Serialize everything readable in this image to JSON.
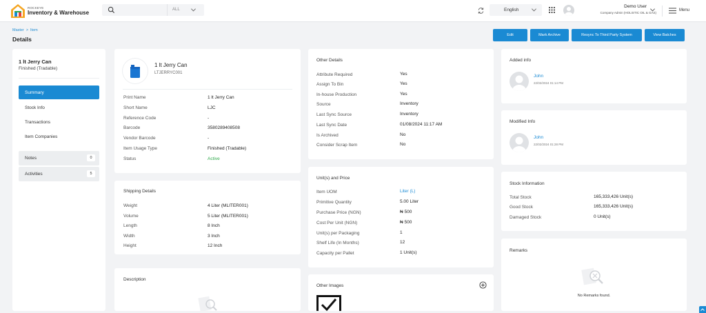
{
  "header": {
    "brand_small": "ROCKEYE",
    "brand_main": "Inventory & Warehouse",
    "search": {
      "placeholder": "",
      "scope": "ALL"
    },
    "language": "English",
    "user_name": "Demo User",
    "user_role": "Company Admin (HOLISTIC OIL & GAS)",
    "menu_label": "Menu"
  },
  "breadcrumb": {
    "root": "Master",
    "current": "Item"
  },
  "page_title": "Details",
  "actions": {
    "edit": "Edit",
    "mark_archive": "Mark Archive",
    "resync": "Resync To Third Party System",
    "view_batches": "View Batches"
  },
  "sidebar": {
    "item_name": "1 lt Jerry Can",
    "item_type": "Finished (Tradable)",
    "nav": [
      "Summary",
      "Stock Info",
      "Transactions",
      "Item Companies"
    ],
    "notes": {
      "label": "Notes",
      "count": "0"
    },
    "activities": {
      "label": "Activities",
      "count": "5"
    }
  },
  "item_card": {
    "name": "1 lt Jerry Can",
    "code": "LTJERRYC001",
    "fields": [
      {
        "label": "Print Name",
        "value": "1 lt Jerry Can"
      },
      {
        "label": "Short Name",
        "value": "LJC"
      },
      {
        "label": "Reference Code",
        "value": "-"
      },
      {
        "label": "Barcode",
        "value": "3580289408508"
      },
      {
        "label": "Vendor Barcode",
        "value": "-"
      },
      {
        "label": "Item Usage Type",
        "value": "Finished (Tradable)"
      },
      {
        "label": "Status",
        "value": "Active"
      }
    ],
    "status_color": "#2ea84a"
  },
  "shipping": {
    "title": "Shipping Details",
    "fields": [
      {
        "label": "Weight",
        "value": "4 Liter (MLITER001)"
      },
      {
        "label": "Volume",
        "value": "5 Liter (MLITER001)"
      },
      {
        "label": "Length",
        "value": "8 Inch"
      },
      {
        "label": "Width",
        "value": "3 Inch"
      },
      {
        "label": "Height",
        "value": "12 Inch"
      }
    ]
  },
  "description": {
    "title": "Description"
  },
  "other_details": {
    "title": "Other Details",
    "fields": [
      {
        "label": "Attribute Required",
        "value": "Yes"
      },
      {
        "label": "Assign To Bin",
        "value": "Yes"
      },
      {
        "label": "In-house Production",
        "value": "Yes"
      },
      {
        "label": "Source",
        "value": "Inventory"
      },
      {
        "label": "Last Sync Source",
        "value": "Inventory"
      },
      {
        "label": "Last Sync Date",
        "value": "01/08/2024 11:17 AM"
      },
      {
        "label": "Is Archived",
        "value": "No"
      },
      {
        "label": "Consider Scrap Item",
        "value": "No"
      }
    ]
  },
  "units": {
    "title": "Unit(s) and Price",
    "fields": [
      {
        "label": "Item UOM",
        "value": "Liter (L)"
      },
      {
        "label": "Primitive Quantity",
        "value": "5.00 Liter"
      },
      {
        "label": "Purchase Price (NGN)",
        "value": "₦ 500"
      },
      {
        "label": "Cost Per Unit (NGN)",
        "value": "₦ 500"
      },
      {
        "label": "Unit(s) per Packaging",
        "value": "1"
      },
      {
        "label": "Shelf Life (In Months)",
        "value": "12"
      },
      {
        "label": "Capacity per Pallet",
        "value": "1 Unit(s)"
      }
    ]
  },
  "other_images": {
    "title": "Other Images"
  },
  "added_info": {
    "title": "Added info",
    "user": "John",
    "date": "22/02/2024 01:14 PM"
  },
  "modified_info": {
    "title": "Modified Info",
    "user": "John",
    "date": "22/02/2024 01:28 PM"
  },
  "stock": {
    "title": "Stock Information",
    "fields": [
      {
        "label": "Total Stock",
        "value": "165,333,426 Unit(s)"
      },
      {
        "label": "Good Stock",
        "value": "165,333,426 Unit(s)"
      },
      {
        "label": "Damaged Stock",
        "value": "0 Unit(s)"
      }
    ]
  },
  "remarks": {
    "title": "Remarks",
    "empty": "No Remarks found."
  },
  "colors": {
    "accent": "#1a8ad3",
    "background": "#f2f3f5"
  }
}
